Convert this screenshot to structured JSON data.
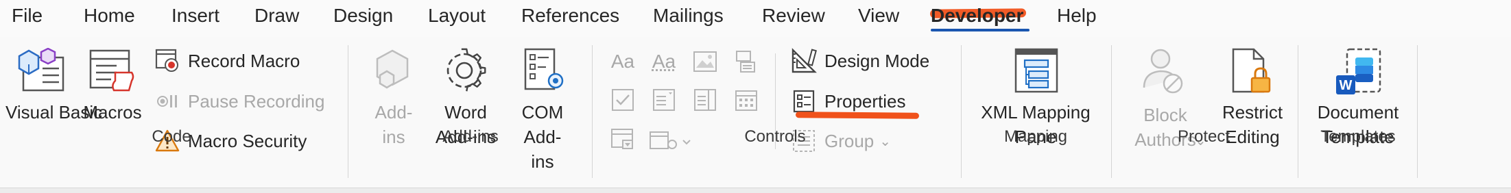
{
  "tabs": [
    "File",
    "Home",
    "Insert",
    "Draw",
    "Design",
    "Layout",
    "References",
    "Mailings",
    "Review",
    "View",
    "Developer",
    "Help"
  ],
  "active_tab": "Developer",
  "groups": {
    "code": {
      "label": "Code",
      "visual_basic": "Visual Basic",
      "macros": "Macros",
      "record_macro": "Record Macro",
      "pause_recording": "Pause Recording",
      "macro_security": "Macro Security"
    },
    "addins": {
      "label": "Add-ins",
      "addins": "Add-ins",
      "word_addins": "Word Add-ins",
      "com_addins": "COM Add-ins"
    },
    "controls": {
      "label": "Controls",
      "design_mode": "Design Mode",
      "properties": "Properties",
      "group": "Group",
      "text_aa_1": "Aa",
      "text_aa_2": "Aa"
    },
    "mapping": {
      "label": "Mapping",
      "xml_mapping_pane": "XML Mapping Pane"
    },
    "protect": {
      "label": "Protect",
      "block_authors": "Block Authors",
      "restrict_editing": "Restrict Editing"
    },
    "templates": {
      "label": "Templates",
      "document_template": "Document Template"
    }
  },
  "colors": {
    "annotation": "#f0521b",
    "active_underline": "#1a56b0",
    "word_blue": "#185abd"
  }
}
